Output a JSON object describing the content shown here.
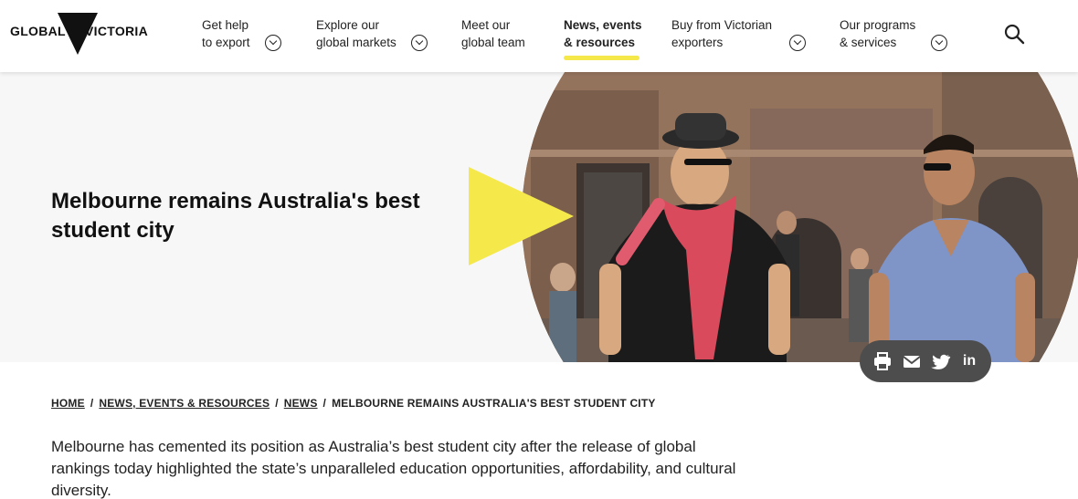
{
  "logo": {
    "left_text": "GLOBAL",
    "right_text": "VICTORIA"
  },
  "nav": {
    "items": [
      {
        "line1": "Get help",
        "line2": "to export"
      },
      {
        "line1": "Explore our",
        "line2": "global markets"
      },
      {
        "line1": "Meet our",
        "line2": "global team"
      },
      {
        "line1": "News, events",
        "line2": "& resources"
      },
      {
        "line1": "Buy from Victorian",
        "line2": "exporters"
      },
      {
        "line1": "Our programs",
        "line2": "& services"
      }
    ]
  },
  "hero": {
    "title": "Melbourne remains Australia's best student city"
  },
  "share": {
    "linkedin_label": "in"
  },
  "breadcrumb": {
    "home": "HOME",
    "section": "NEWS, EVENTS & RESOURCES",
    "news": "NEWS",
    "current": "MELBOURNE REMAINS AUSTRALIA'S BEST STUDENT CITY"
  },
  "article": {
    "intro": "Melbourne has cemented its position as Australia’s best student city after the release of global rankings today highlighted the state’s unparalleled education opportunities, affordability, and cultural diversity."
  },
  "colors": {
    "accent_yellow": "#f5e84a",
    "share_bg": "#4d4d4d",
    "hero_bg": "#f7f7f7"
  }
}
